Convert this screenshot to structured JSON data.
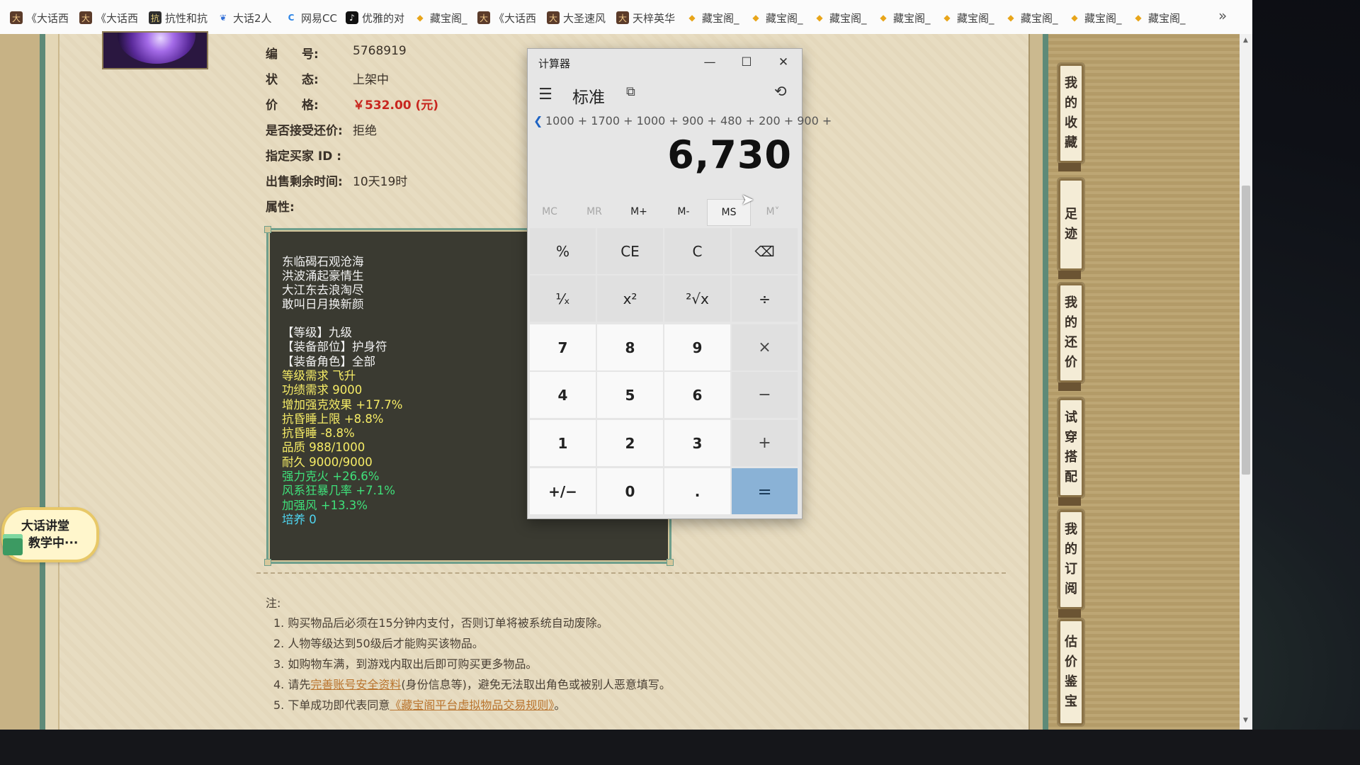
{
  "bookmarks": [
    {
      "icon": "dahua-icon",
      "label": "《大话西"
    },
    {
      "icon": "dahua-icon",
      "label": "《大话西"
    },
    {
      "icon": "game-icon",
      "label": "抗性和抗"
    },
    {
      "icon": "bird-icon",
      "label": "大话2人"
    },
    {
      "icon": "netease-cc-icon",
      "label": "网易CC"
    },
    {
      "icon": "tiktok-icon",
      "label": "优雅的对"
    },
    {
      "icon": "cangbaoge-icon",
      "label": "藏宝阁_"
    },
    {
      "icon": "dahua-icon",
      "label": "《大话西"
    },
    {
      "icon": "dahua-icon",
      "label": "大圣速风"
    },
    {
      "icon": "dahua-icon",
      "label": "天梓英华"
    },
    {
      "icon": "cangbaoge-icon",
      "label": "藏宝阁_"
    },
    {
      "icon": "cangbaoge-icon",
      "label": "藏宝阁_"
    },
    {
      "icon": "cangbaoge-icon",
      "label": "藏宝阁_"
    },
    {
      "icon": "cangbaoge-icon",
      "label": "藏宝阁_"
    },
    {
      "icon": "cangbaoge-icon",
      "label": "藏宝阁_"
    },
    {
      "icon": "cangbaoge-icon",
      "label": "藏宝阁_"
    },
    {
      "icon": "cangbaoge-icon",
      "label": "藏宝阁_"
    },
    {
      "icon": "cangbaoge-icon",
      "label": "藏宝阁_"
    }
  ],
  "bookmarks_more": "»",
  "item": {
    "id_label": "编　　号:",
    "id_value": "5768919",
    "status_label": "状　　态:",
    "status_value": "上架中",
    "price_label": "价　　格:",
    "price_value": "￥532.00 (元)",
    "bargain_label": "是否接受还价:",
    "bargain_value": "拒绝",
    "buyer_label": "指定买家 ID :",
    "remaining_label": "出售剩余时间:",
    "remaining_value": "10天19时",
    "attr_label": "属性:"
  },
  "attributes": {
    "poem": [
      "东临碣石观沧海",
      "洪波涌起豪情生",
      "大江东去浪淘尽",
      "敢叫日月换新颜"
    ],
    "lines": [
      {
        "text": "【等级】九级",
        "color": "white"
      },
      {
        "text": "【装备部位】护身符",
        "color": "white"
      },
      {
        "text": "【装备角色】全部",
        "color": "white"
      },
      {
        "text": "等级需求 飞升",
        "color": "yellow"
      },
      {
        "text": "功绩需求 9000",
        "color": "yellow"
      },
      {
        "text": "增加强克效果 +17.7%",
        "color": "yellow"
      },
      {
        "text": "抗昏睡上限 +8.8%",
        "color": "yellow"
      },
      {
        "text": "抗昏睡 -8.8%",
        "color": "yellow"
      },
      {
        "text": "品质 988/1000",
        "color": "yellow"
      },
      {
        "text": "耐久 9000/9000",
        "color": "yellow"
      },
      {
        "text": "强力克火 +26.6%",
        "color": "green"
      },
      {
        "text": "风系狂暴几率 +7.1%",
        "color": "green"
      },
      {
        "text": "加强风 +13.3%",
        "color": "green"
      },
      {
        "text": "培养 0",
        "color": "cyan"
      }
    ]
  },
  "notes": {
    "title": "注:",
    "items": [
      {
        "pre": "1. 购买物品后必须在15分钟内支付，否则订单将被系统自动废除。",
        "link": "",
        "post": ""
      },
      {
        "pre": "2. 人物等级达到50级后才能购买该物品。",
        "link": "",
        "post": ""
      },
      {
        "pre": "3. 如购物车满，到游戏内取出后即可购买更多物品。",
        "link": "",
        "post": ""
      },
      {
        "pre": "4. 请先",
        "link": "完善账号安全资料",
        "post": "(身份信息等)，避免无法取出角色或被别人恶意填写。"
      },
      {
        "pre": "5. 下单成功即代表同意",
        "link": "《藏宝阁平台虚拟物品交易规则》",
        "post": "。"
      }
    ]
  },
  "tutor_badge": {
    "line1": "大话讲堂",
    "line2": "教学中···"
  },
  "right_rail": [
    {
      "label": "我的收藏",
      "chars": [
        "我",
        "的",
        "收",
        "藏"
      ]
    },
    {
      "label": "足迹",
      "chars": [
        "足",
        "迹"
      ]
    },
    {
      "label": "我的还价",
      "chars": [
        "我",
        "的",
        "还",
        "价"
      ]
    },
    {
      "label": "试穿搭配",
      "chars": [
        "试",
        "穿",
        "搭",
        "配"
      ]
    },
    {
      "label": "我的订阅",
      "chars": [
        "我",
        "的",
        "订",
        "阅"
      ]
    },
    {
      "label": "估价鉴宝",
      "chars": [
        "估",
        "价",
        "鉴",
        "宝"
      ]
    }
  ],
  "calculator": {
    "title": "计算器",
    "mode": "标准",
    "expression": "1000 + 1700 + 1000 + 900 + 480 + 200 + 900 +",
    "display": "6,730",
    "memory": [
      {
        "label": "MC",
        "enabled": false
      },
      {
        "label": "MR",
        "enabled": false
      },
      {
        "label": "M+",
        "enabled": true
      },
      {
        "label": "M-",
        "enabled": true
      },
      {
        "label": "MS",
        "enabled": true
      },
      {
        "label": "M˅",
        "enabled": false
      }
    ],
    "keys": [
      [
        "%",
        "CE",
        "C",
        "⌫"
      ],
      [
        "¹⁄ₓ",
        "x²",
        "²√x",
        "÷"
      ],
      [
        "7",
        "8",
        "9",
        "×"
      ],
      [
        "4",
        "5",
        "6",
        "−"
      ],
      [
        "1",
        "2",
        "3",
        "+"
      ],
      [
        "+/−",
        "0",
        ".",
        "="
      ]
    ]
  },
  "colors": {
    "price": "#c8261f",
    "attr_white": "#f1f1f1",
    "attr_yellow": "#f6ec66",
    "attr_green": "#3fe07a",
    "attr_cyan": "#4fd5f0",
    "equals_key": "#8ab2d6",
    "link": "#b9742e"
  }
}
